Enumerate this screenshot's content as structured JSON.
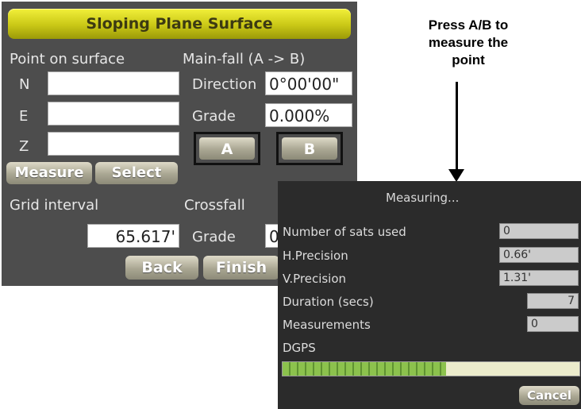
{
  "main": {
    "title": "Sloping Plane Surface",
    "point_on_surface_label": "Point on surface",
    "n_label": "N",
    "e_label": "E",
    "z_label": "Z",
    "n_value": "",
    "e_value": "",
    "z_value": "",
    "measure_label": "Measure",
    "select_label": "Select",
    "mainfall_label": "Main-fall (A -> B)",
    "direction_label": "Direction",
    "direction_value": "0°00'00\"",
    "grade_label": "Grade",
    "grade_value": "0.000%",
    "a_label": "A",
    "b_label": "B",
    "grid_interval_label": "Grid interval",
    "grid_interval_value": "65.617'",
    "crossfall_label": "Crossfall",
    "crossfall_grade_label": "Grade",
    "crossfall_grade_value": "0",
    "back_label": "Back",
    "finish_label": "Finish"
  },
  "annotation": {
    "line1": "Press A/B to",
    "line2": "measure the",
    "line3": "point"
  },
  "dialog": {
    "title": "Measuring...",
    "sats_label": "Number of sats used",
    "sats_value": "0",
    "hprec_label": "H.Precision",
    "hprec_value": "0.66'",
    "vprec_label": "V.Precision",
    "vprec_value": "1.31'",
    "duration_label": "Duration (secs)",
    "duration_value": "7",
    "measurements_label": "Measurements",
    "measurements_value": "0",
    "mode_label": "DGPS",
    "progress_fraction": 0.55,
    "cancel_label": "Cancel"
  }
}
